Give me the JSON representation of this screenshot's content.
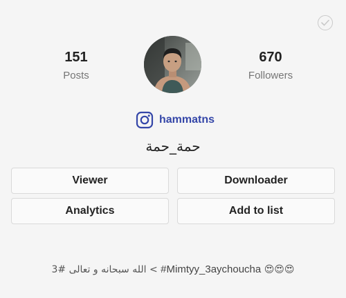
{
  "profile": {
    "username": "hammatns",
    "full_name": "حمة_حمة",
    "bio_arabic": "الله سبحانه و تعالى #3",
    "bio_tag": "#Mimtyy_3aychoucha",
    "bio_prefix": "<",
    "bio_emoji": "😍😍😍"
  },
  "stats": {
    "posts_count": "151",
    "posts_label": "Posts",
    "followers_count": "670",
    "followers_label": "Followers"
  },
  "actions": {
    "viewer": "Viewer",
    "downloader": "Downloader",
    "analytics": "Analytics",
    "add_to_list": "Add to list"
  },
  "icons": {
    "select": "check-circle-icon",
    "instagram": "instagram-icon"
  },
  "colors": {
    "accent": "#3446a8",
    "background": "#f5f5f5"
  }
}
